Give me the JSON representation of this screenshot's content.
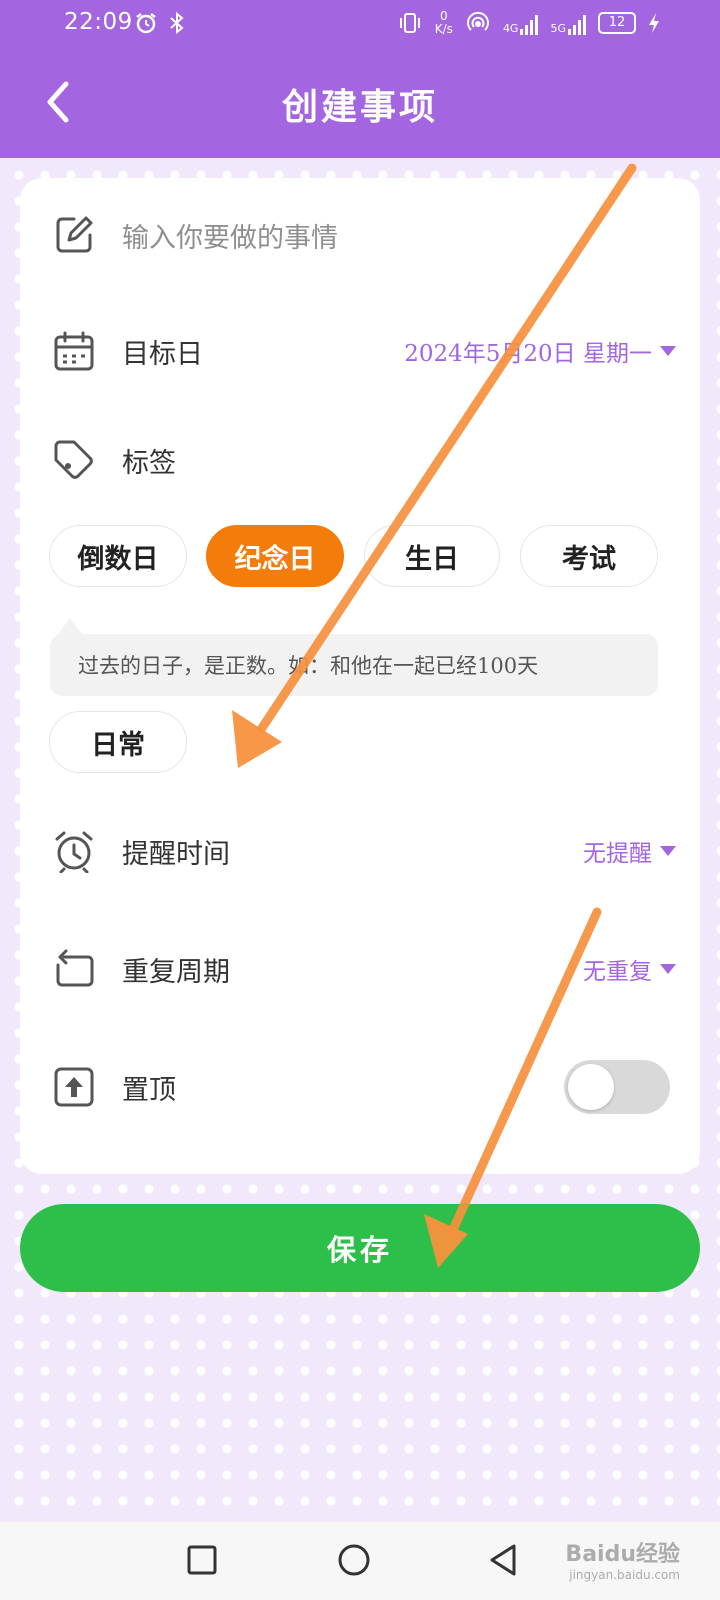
{
  "status_bar": {
    "time": "22:09",
    "speed_value": "0",
    "speed_unit": "K/s",
    "net1": "4G",
    "net2": "5G",
    "battery": "12"
  },
  "header": {
    "title": "创建事项",
    "background_color": "#a366e0"
  },
  "form": {
    "title_input_placeholder": "输入你要做的事情",
    "target_date": {
      "label": "目标日",
      "value": "2024年5月20日 星期一"
    },
    "tags": {
      "label": "标签",
      "items": [
        "倒数日",
        "纪念日",
        "生日",
        "考试",
        "日常"
      ],
      "selected": "纪念日",
      "hint": "过去的日子，是正数。如：和他在一起已经100天"
    },
    "reminder": {
      "label": "提醒时间",
      "value": "无提醒"
    },
    "repeat": {
      "label": "重复周期",
      "value": "无重复"
    },
    "pin": {
      "label": "置顶",
      "enabled": false
    },
    "accent_color": "#a366e0"
  },
  "save_button": {
    "label": "保存",
    "color": "#2ebf4b"
  },
  "watermark": {
    "text": "Baidu经验",
    "url": "jingyan.baidu.com"
  }
}
